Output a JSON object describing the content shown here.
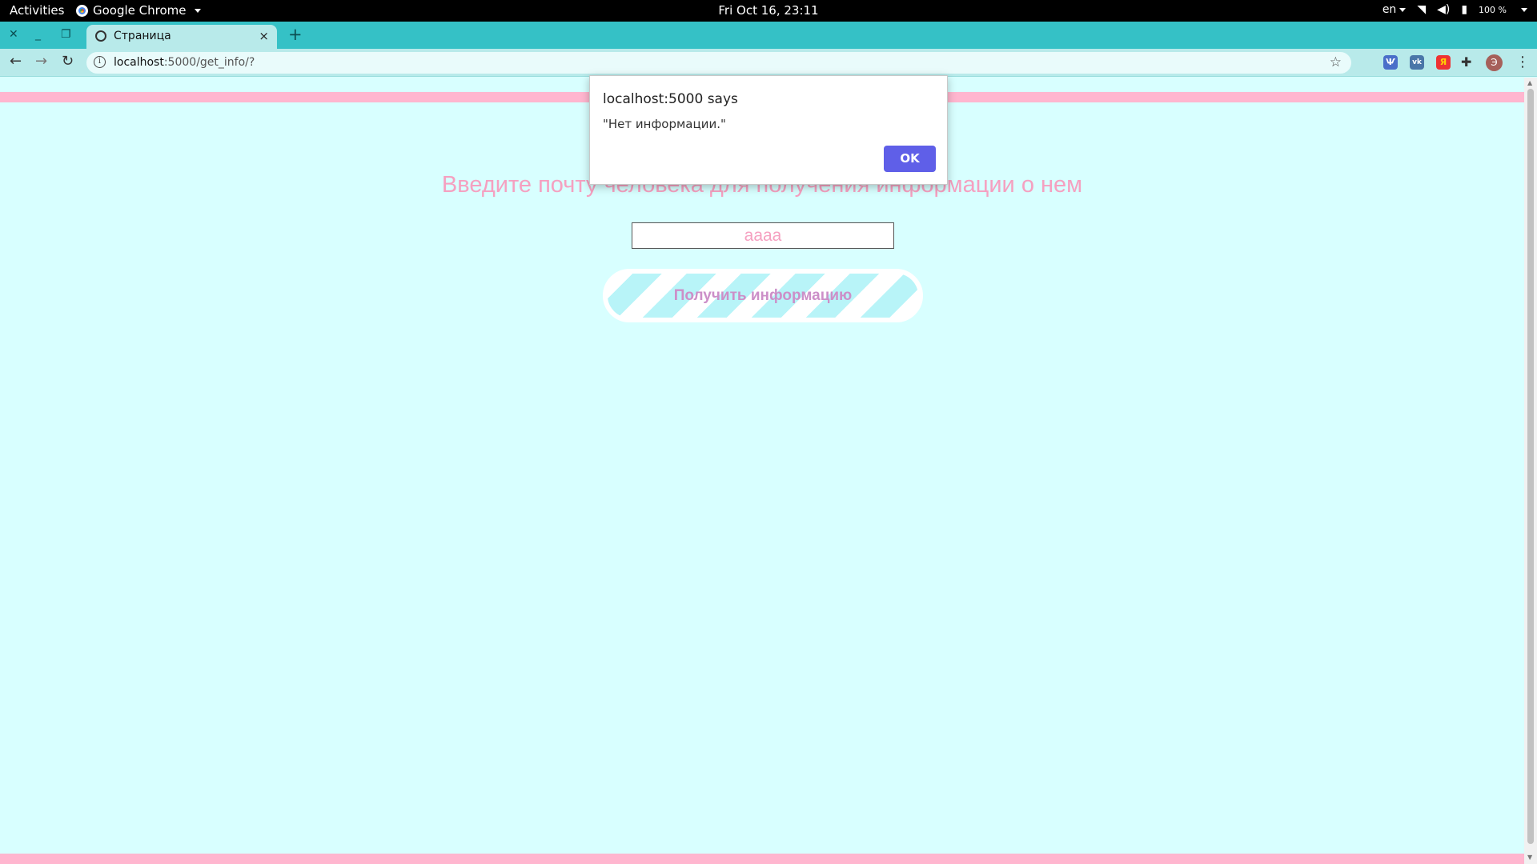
{
  "system_bar": {
    "activities": "Activities",
    "app_name": "Google Chrome",
    "clock": "Fri Oct 16, 23:11",
    "language": "en",
    "battery": "100 %"
  },
  "browser": {
    "tab_title": "Страница",
    "tab_close": "×",
    "new_tab": "+",
    "url_host": "localhost",
    "url_path": ":5000/get_info/?",
    "avatar_letter": "Э",
    "extensions": [
      "Ѱ",
      "vk",
      "Я"
    ]
  },
  "page": {
    "heading": "Введите почту человека для получения информации о нем",
    "email_value": "aaaa",
    "submit_label": "Получить информацию",
    "colors": {
      "background": "#d8ffff",
      "accent_pink": "#ffb6cf",
      "text_pink": "#f5a0c0",
      "button_text": "#cc8fc8"
    }
  },
  "dialog": {
    "origin": "localhost:5000 says",
    "message": "\"Нет информации.\"",
    "ok_label": "OK",
    "ok_color": "#5f5fe8"
  }
}
